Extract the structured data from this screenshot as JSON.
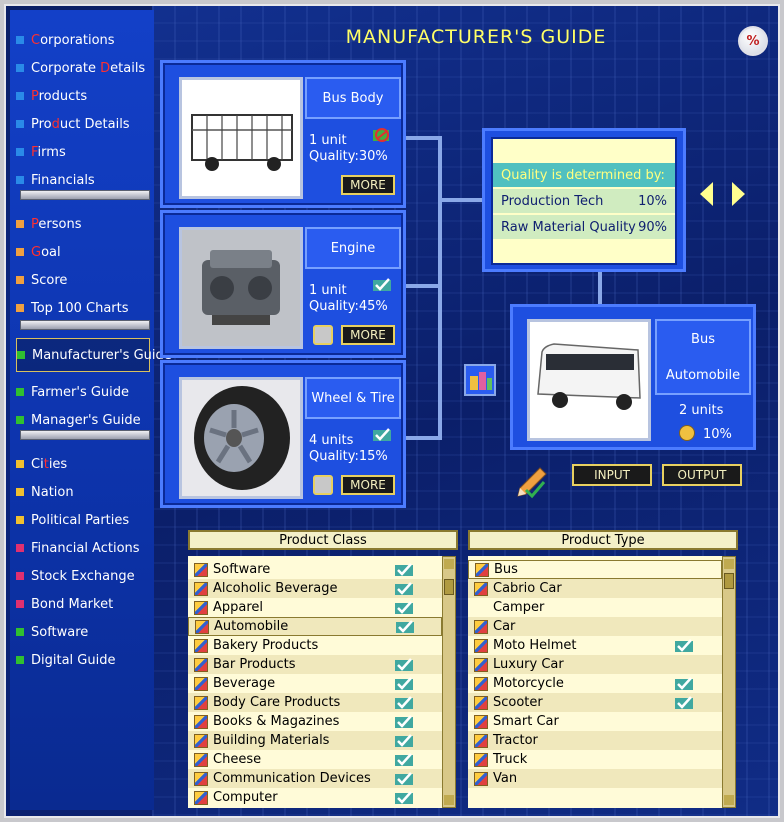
{
  "title": "MANUFACTURER'S GUIDE",
  "percent_button": "%",
  "sidebar": {
    "items": [
      {
        "first": "C",
        "rest": "orporations",
        "color": "#2a8ae8"
      },
      {
        "first": "Corporate ",
        "hl": "D",
        "rest": "etails",
        "color": "#2a8ae8"
      },
      {
        "first": "P",
        "rest": "roducts",
        "color": "#2a8ae8"
      },
      {
        "first": "Pro",
        "hl": "d",
        "rest": "uct Details",
        "color": "#2a8ae8"
      },
      {
        "first": "F",
        "rest": "irms",
        "color": "#2a8ae8"
      },
      {
        "label": "Financials",
        "color": "#2a8ae8"
      },
      {
        "first": "P",
        "rest": "ersons",
        "color": "#f0a040"
      },
      {
        "first": "G",
        "rest": "oal",
        "color": "#f0a040"
      },
      {
        "label": "Score",
        "color": "#f0a040"
      },
      {
        "label": "Top 100 Charts",
        "color": "#f0a040"
      },
      {
        "label": "Manufacturer's Guide",
        "color": "#30c030"
      },
      {
        "label": "Farmer's Guide",
        "color": "#30c030"
      },
      {
        "label": "Manager's Guide",
        "color": "#30c030"
      },
      {
        "first": "Ci",
        "hl": "t",
        "rest": "ies",
        "color": "#f0c030"
      },
      {
        "label": "Nation",
        "color": "#f0c030"
      },
      {
        "label": "Political Parties",
        "color": "#f0c030"
      },
      {
        "label": "Financial Actions",
        "color": "#e03070"
      },
      {
        "label": "Stock Exchange",
        "color": "#e03070"
      },
      {
        "label": "Bond Market",
        "color": "#e03070"
      },
      {
        "label": "Software",
        "color": "#30c030"
      },
      {
        "label": "Digital Guide",
        "color": "#30c030"
      }
    ]
  },
  "components": [
    {
      "name": "Bus Body",
      "units": "1 unit",
      "quality": "Quality:30%",
      "more": "MORE"
    },
    {
      "name": "Engine",
      "units": "1 unit",
      "quality": "Quality:45%",
      "more": "MORE"
    },
    {
      "name": "Wheel & Tire",
      "units": "4 units",
      "quality": "Quality:15%",
      "more": "MORE"
    }
  ],
  "quality_panel": {
    "header": "Quality is determined by:",
    "rows": [
      {
        "label": "Production Tech",
        "value": "10%"
      },
      {
        "label": "Raw Material Quality",
        "value": "90%"
      }
    ]
  },
  "product": {
    "name": "Bus",
    "class": "Automobile",
    "units": "2 units",
    "pct": "10%"
  },
  "buttons": {
    "input": "INPUT",
    "output": "OUTPUT"
  },
  "product_class": {
    "header": "Product Class",
    "items": [
      {
        "label": "Software",
        "tick": true
      },
      {
        "label": "Alcoholic Beverage",
        "tick": true
      },
      {
        "label": "Apparel",
        "tick": true
      },
      {
        "label": "Automobile",
        "tick": true,
        "selected": true
      },
      {
        "label": "Bakery Products",
        "tick": false
      },
      {
        "label": "Bar Products",
        "tick": true
      },
      {
        "label": "Beverage",
        "tick": true
      },
      {
        "label": "Body Care Products",
        "tick": true
      },
      {
        "label": "Books & Magazines",
        "tick": true
      },
      {
        "label": "Building Materials",
        "tick": true
      },
      {
        "label": "Cheese",
        "tick": true
      },
      {
        "label": "Communication Devices",
        "tick": true
      },
      {
        "label": "Computer",
        "tick": true
      }
    ]
  },
  "product_type": {
    "header": "Product Type",
    "items": [
      {
        "label": "Bus",
        "icon": true,
        "tick": false,
        "selected": true
      },
      {
        "label": "Cabrio Car",
        "icon": true,
        "tick": false
      },
      {
        "label": "Camper",
        "icon": false,
        "tick": false
      },
      {
        "label": "Car",
        "icon": true,
        "tick": false
      },
      {
        "label": "Moto Helmet",
        "icon": true,
        "tick": true
      },
      {
        "label": "Luxury Car",
        "icon": true,
        "tick": false
      },
      {
        "label": "Motorcycle",
        "icon": true,
        "tick": true
      },
      {
        "label": "Scooter",
        "icon": true,
        "tick": true
      },
      {
        "label": "Smart Car",
        "icon": true,
        "tick": false
      },
      {
        "label": "Tractor",
        "icon": true,
        "tick": false
      },
      {
        "label": "Truck",
        "icon": true,
        "tick": false
      },
      {
        "label": "Van",
        "icon": true,
        "tick": false
      }
    ]
  }
}
